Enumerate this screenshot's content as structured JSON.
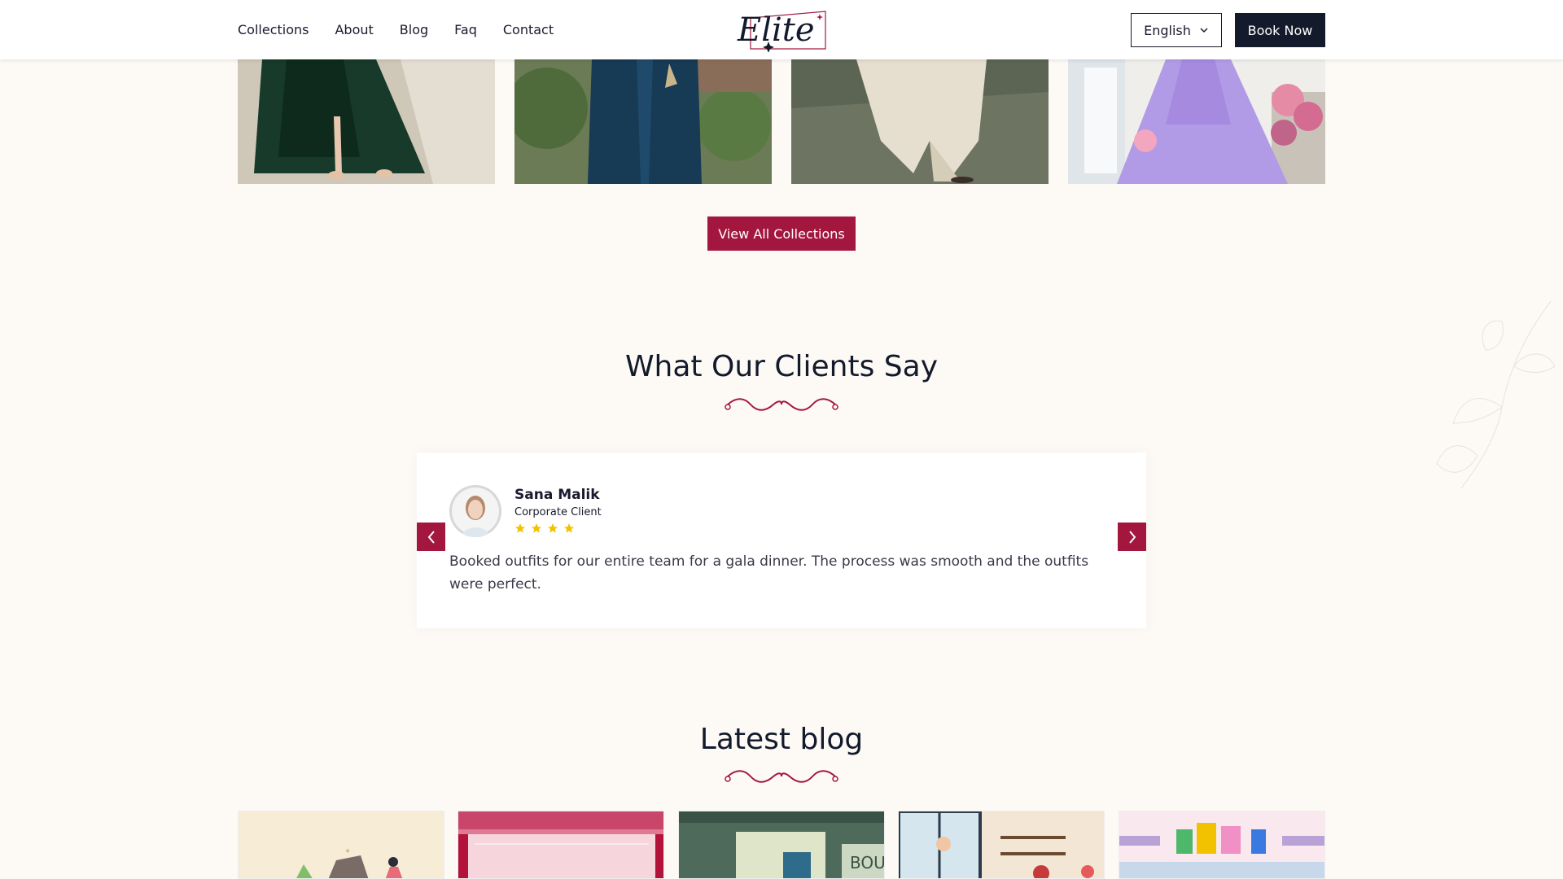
{
  "header": {
    "nav": [
      "Collections",
      "About",
      "Blog",
      "Faq",
      "Contact"
    ],
    "logo_text": "Elite",
    "language": "English",
    "book_label": "Book Now"
  },
  "collections": {
    "images": [
      "green-velvet-gown",
      "teal-sherwani",
      "cream-kurta",
      "lavender-princess-dress"
    ],
    "view_all_label": "View All Collections"
  },
  "testimonials": {
    "title": "What Our Clients Say",
    "item": {
      "name": "Sana Malik",
      "role": "Corporate Client",
      "rating": 4,
      "quote": "Booked outfits for our entire team for a gala dinner. The process was smooth and the outfits were perfect."
    }
  },
  "blog": {
    "title": "Latest blog",
    "posts": [
      "blog-image-1",
      "blog-image-2",
      "blog-image-3",
      "blog-image-4",
      "blog-image-5"
    ],
    "post3_sign": "BOUT"
  },
  "colors": {
    "accent": "#a3173f",
    "dark": "#131a2b",
    "background": "#fdfaf6",
    "star": "#f2c200"
  }
}
